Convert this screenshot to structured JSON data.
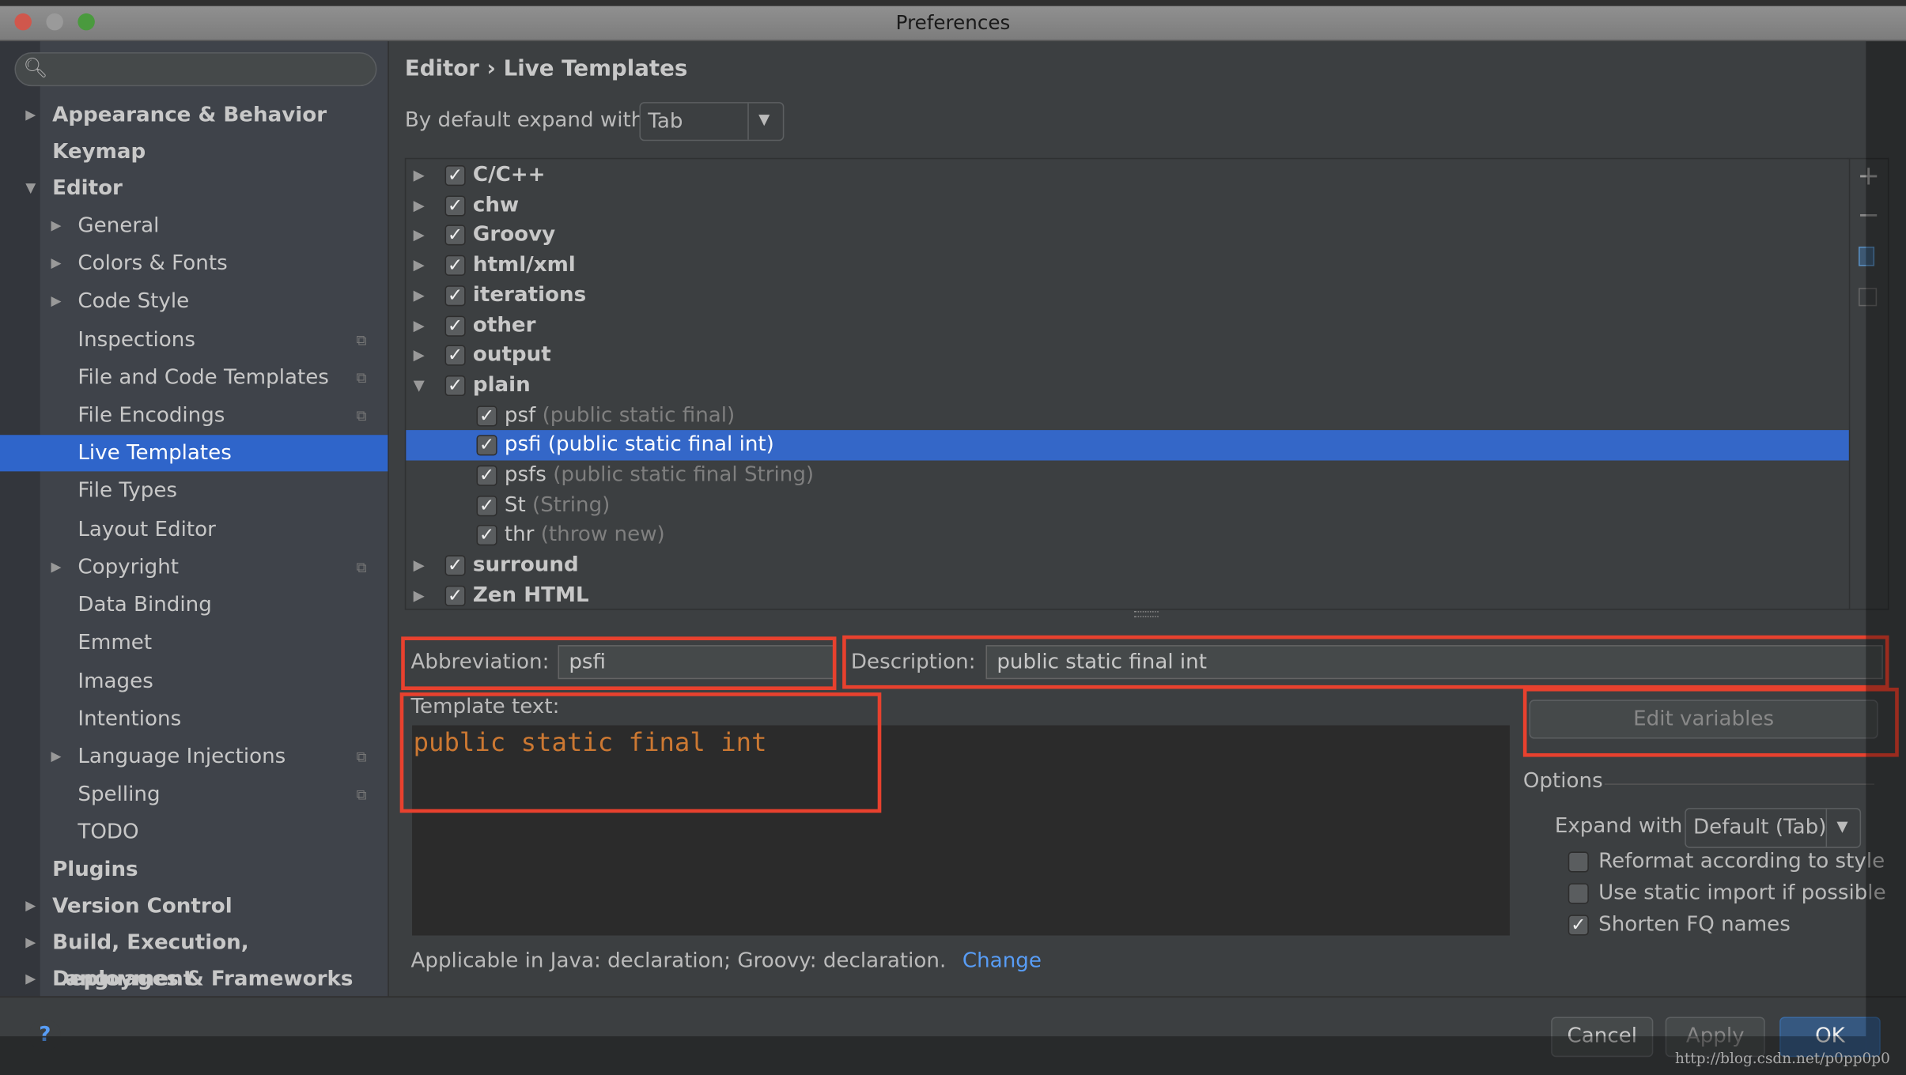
{
  "window": {
    "title": "Preferences"
  },
  "sidebar": {
    "search_placeholder": "",
    "items": [
      {
        "label": "Appearance & Behavior",
        "level": 0,
        "arrow": "right"
      },
      {
        "label": "Keymap",
        "level": 0
      },
      {
        "label": "Editor",
        "level": 0,
        "arrow": "down"
      },
      {
        "label": "General",
        "level": 1,
        "arrow": "right"
      },
      {
        "label": "Colors & Fonts",
        "level": 1,
        "arrow": "right"
      },
      {
        "label": "Code Style",
        "level": 1,
        "arrow": "right"
      },
      {
        "label": "Inspections",
        "level": 1,
        "copy": true
      },
      {
        "label": "File and Code Templates",
        "level": 1,
        "copy": true
      },
      {
        "label": "File Encodings",
        "level": 1,
        "copy": true
      },
      {
        "label": "Live Templates",
        "level": 1,
        "selected": true
      },
      {
        "label": "File Types",
        "level": 1
      },
      {
        "label": "Layout Editor",
        "level": 1
      },
      {
        "label": "Copyright",
        "level": 1,
        "arrow": "right",
        "copy": true
      },
      {
        "label": "Data Binding",
        "level": 1
      },
      {
        "label": "Emmet",
        "level": 1
      },
      {
        "label": "Images",
        "level": 1
      },
      {
        "label": "Intentions",
        "level": 1
      },
      {
        "label": "Language Injections",
        "level": 1,
        "arrow": "right",
        "copy": true
      },
      {
        "label": "Spelling",
        "level": 1,
        "copy": true
      },
      {
        "label": "TODO",
        "level": 1
      },
      {
        "label": "Plugins",
        "level": 0
      },
      {
        "label": "Version Control",
        "level": 0,
        "arrow": "right"
      },
      {
        "label": "Build, Execution, Deployment",
        "level": 0,
        "arrow": "right"
      },
      {
        "label": "Languages & Frameworks",
        "level": 0,
        "arrow": "right"
      }
    ]
  },
  "breadcrumb": {
    "parent": "Editor",
    "separator": "›",
    "current": "Live Templates"
  },
  "expand_default": {
    "label": "By default expand with",
    "value": "Tab"
  },
  "tree": [
    {
      "name": "C/C++",
      "group": true,
      "checked": true
    },
    {
      "name": "chw",
      "group": true,
      "checked": true
    },
    {
      "name": "Groovy",
      "group": true,
      "checked": true
    },
    {
      "name": "html/xml",
      "group": true,
      "checked": true
    },
    {
      "name": "iterations",
      "group": true,
      "checked": true
    },
    {
      "name": "other",
      "group": true,
      "checked": true
    },
    {
      "name": "output",
      "group": true,
      "checked": true
    },
    {
      "name": "plain",
      "group": true,
      "checked": true,
      "expanded": true
    },
    {
      "name": "psf",
      "desc": "(public static final)",
      "checked": true
    },
    {
      "name": "psfi",
      "desc": "(public static final int)",
      "checked": true,
      "selected": true
    },
    {
      "name": "psfs",
      "desc": "(public static final String)",
      "checked": true
    },
    {
      "name": "St",
      "desc": "(String)",
      "checked": true
    },
    {
      "name": "thr",
      "desc": "(throw new)",
      "checked": true
    },
    {
      "name": "surround",
      "group": true,
      "checked": true
    },
    {
      "name": "Zen HTML",
      "group": true,
      "checked": true
    }
  ],
  "toolbar": [
    "add-icon",
    "remove-icon",
    "copy-icon",
    "restore-icon"
  ],
  "editor": {
    "abbreviation_label": "Abbreviation:",
    "abbreviation": "psfi",
    "description_label": "Description:",
    "description": "public static final int",
    "template_label": "Template text:",
    "template_text": "public static final int",
    "edit_variables": "Edit variables",
    "applicable": "Applicable in Java: declaration; Groovy: declaration.",
    "change_link": "Change"
  },
  "options": {
    "title": "Options",
    "expand_label": "Expand with",
    "expand_value": "Default (Tab)",
    "checkboxes": [
      {
        "label": "Reformat according to style",
        "checked": false
      },
      {
        "label": "Use static import if possible",
        "checked": false
      },
      {
        "label": "Shorten FQ names",
        "checked": true
      }
    ]
  },
  "buttons": {
    "cancel": "Cancel",
    "apply": "Apply",
    "ok": "OK",
    "help": "?"
  },
  "watermark": "http://blog.csdn.net/p0pp0p0",
  "colors": {
    "selection": "#2f65ca",
    "code": "#cc7832",
    "link": "#589df6",
    "highlight_box": "#e8412e"
  }
}
